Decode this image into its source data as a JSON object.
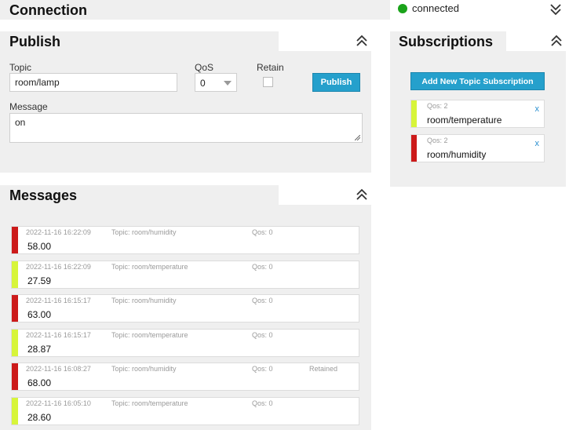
{
  "connection": {
    "title": "Connection",
    "status": "connected",
    "status_color": "#1aa31a"
  },
  "publish": {
    "title": "Publish",
    "topic_label": "Topic",
    "topic_value": "room/lamp",
    "qos_label": "QoS",
    "qos_value": "0",
    "retain_label": "Retain",
    "button_label": "Publish",
    "message_label": "Message",
    "message_value": "on"
  },
  "subscriptions": {
    "title": "Subscriptions",
    "add_button": "Add New Topic Subscription",
    "items": [
      {
        "qos": "Qos: 2",
        "topic": "room/temperature",
        "color": "#d7f53a",
        "remove": "x"
      },
      {
        "qos": "Qos: 2",
        "topic": "room/humidity",
        "color": "#cc1a1a",
        "remove": "x"
      }
    ]
  },
  "messages": {
    "title": "Messages",
    "items": [
      {
        "time": "2022-11-16 16:22:09",
        "topic": "Topic: room/humidity",
        "qos": "Qos: 0",
        "retained": "",
        "value": "58.00",
        "color": "#cc1a1a"
      },
      {
        "time": "2022-11-16 16:22:09",
        "topic": "Topic: room/temperature",
        "qos": "Qos: 0",
        "retained": "",
        "value": "27.59",
        "color": "#d7f53a"
      },
      {
        "time": "2022-11-16 16:15:17",
        "topic": "Topic: room/humidity",
        "qos": "Qos: 0",
        "retained": "",
        "value": "63.00",
        "color": "#cc1a1a"
      },
      {
        "time": "2022-11-16 16:15:17",
        "topic": "Topic: room/temperature",
        "qos": "Qos: 0",
        "retained": "",
        "value": "28.87",
        "color": "#d7f53a"
      },
      {
        "time": "2022-11-16 16:08:27",
        "topic": "Topic: room/humidity",
        "qos": "Qos: 0",
        "retained": "Retained",
        "value": "68.00",
        "color": "#cc1a1a"
      },
      {
        "time": "2022-11-16 16:05:10",
        "topic": "Topic: room/temperature",
        "qos": "Qos: 0",
        "retained": "",
        "value": "28.60",
        "color": "#d7f53a"
      }
    ]
  }
}
